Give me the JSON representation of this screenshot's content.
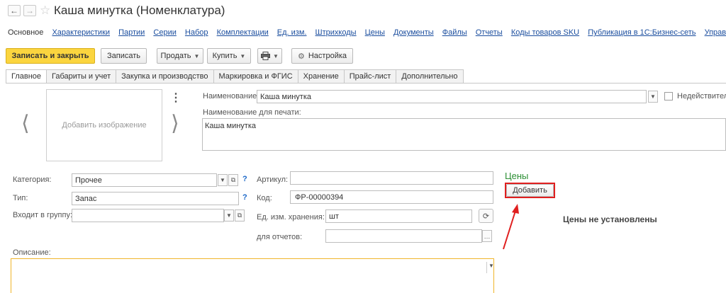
{
  "window": {
    "title": "Каша минутка (Номенклатура)"
  },
  "nav_links": [
    "Основное",
    "Характеристики",
    "Партии",
    "Серии",
    "Набор",
    "Комплектации",
    "Ед. изм.",
    "Штрихкоды",
    "Цены",
    "Документы",
    "Файлы",
    "Отчеты",
    "Коды товаров SKU",
    "Публикация в 1С:Бизнес-сеть",
    "Управле"
  ],
  "toolbar": {
    "save_close": "Записать и закрыть",
    "save": "Записать",
    "sell": "Продать",
    "buy": "Купить",
    "print_icon": "printer-icon",
    "settings": "Настройка",
    "settings_icon": "gear-icon"
  },
  "tabs": [
    "Главное",
    "Габариты и учет",
    "Закупка и производство",
    "Маркировка и ФГИС",
    "Хранение",
    "Прайс-лист",
    "Дополнительно"
  ],
  "active_tab": "Главное",
  "image": {
    "placeholder": "Добавить изображение"
  },
  "form": {
    "name_label": "Наименование:",
    "name_value": "Каша минутка",
    "invalid_label": "Недействитель",
    "print_name_label": "Наименование для печати:",
    "print_name_value": "Каша минутка",
    "category_label": "Категория:",
    "category_value": "Прочее",
    "type_label": "Тип:",
    "type_value": "Запас",
    "group_label": "Входит в группу:",
    "group_value": "",
    "article_label": "Артикул:",
    "article_value": "",
    "code_label": "Код:",
    "code_value": "ФР-00000394",
    "unit_label": "Ед. изм. хранения:",
    "unit_value": "шт",
    "reports_label": "для отчетов:",
    "reports_value": "",
    "description_label": "Описание:",
    "description_value": "",
    "help_mark": "?"
  },
  "prices": {
    "title": "Цены",
    "add_button": "Добавить",
    "empty_text": "Цены не установлены"
  },
  "colors": {
    "primary_button": "#fbd53f",
    "link": "#1a4d9e",
    "prices_title": "#2c8f34",
    "highlight": "#e01f1f",
    "description_border": "#f0b52a"
  }
}
